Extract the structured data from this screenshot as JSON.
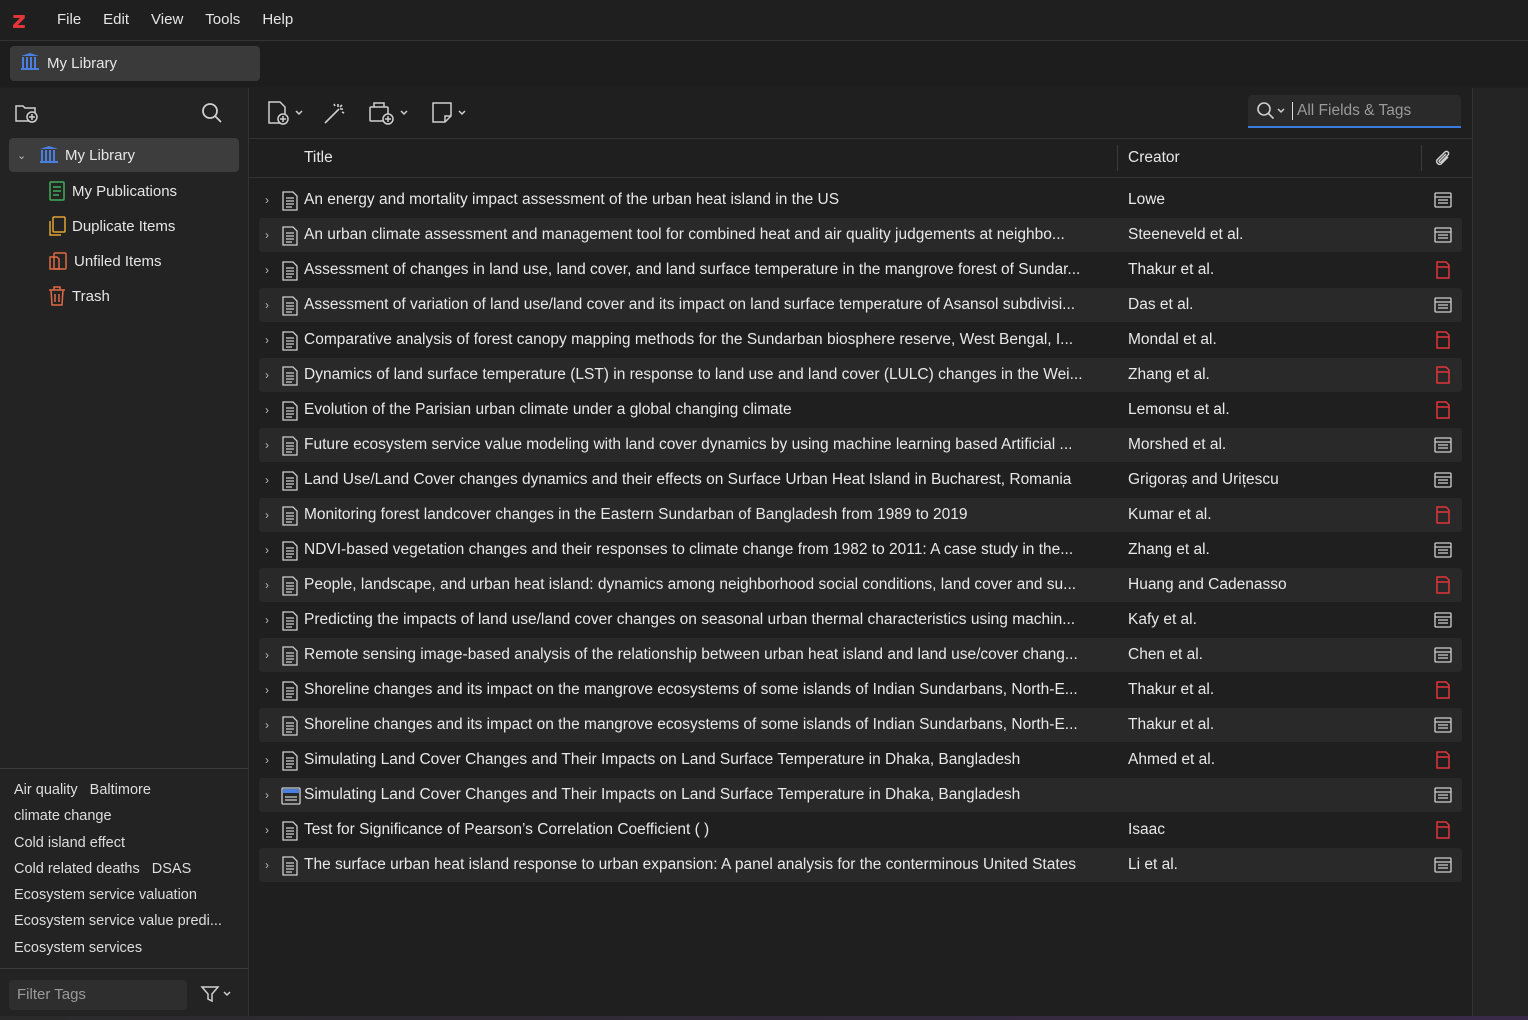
{
  "app": {
    "logo_letter": "z",
    "brand_color": "#e0353a"
  },
  "menu": [
    "File",
    "Edit",
    "View",
    "Tools",
    "Help"
  ],
  "tab": {
    "label": "My Library"
  },
  "sidebar": {
    "tree": [
      {
        "label": "My Library",
        "icon": "library-icon",
        "selected": true
      },
      {
        "label": "My Publications",
        "icon": "publications-icon"
      },
      {
        "label": "Duplicate Items",
        "icon": "duplicate-icon"
      },
      {
        "label": "Unfiled Items",
        "icon": "unfiled-icon"
      },
      {
        "label": "Trash",
        "icon": "trash-icon"
      }
    ],
    "tags": [
      [
        "Air quality",
        "Baltimore"
      ],
      [
        "climate change"
      ],
      [
        "Cold island effect"
      ],
      [
        "Cold related deaths",
        "DSAS"
      ],
      [
        "Ecosystem service valuation"
      ],
      [
        "Ecosystem service value predi..."
      ],
      [
        "Ecosystem services"
      ]
    ],
    "filter_placeholder": "Filter Tags"
  },
  "search": {
    "placeholder": "All Fields & Tags"
  },
  "columns": {
    "title": "Title",
    "creator": "Creator"
  },
  "items": [
    {
      "title": "An energy and mortality impact assessment of the urban heat island in the US",
      "creator": "Lowe",
      "att": "snapshot"
    },
    {
      "title": "An urban climate assessment and management tool for combined heat and air quality judgements at neighbo...",
      "creator": "Steeneveld et al.",
      "att": "snapshot"
    },
    {
      "title": "Assessment of changes in land use, land cover, and land surface temperature in the mangrove forest of Sundar...",
      "creator": "Thakur et al.",
      "att": "pdf"
    },
    {
      "title": "Assessment of variation of land use/land cover and its impact on land surface temperature of Asansol subdivisi...",
      "creator": "Das et al.",
      "att": "snapshot"
    },
    {
      "title": "Comparative analysis of forest canopy mapping methods for the Sundarban biosphere reserve, West Bengal, I...",
      "creator": "Mondal et al.",
      "att": "pdf"
    },
    {
      "title": "Dynamics of land surface temperature (LST) in response to land use and land cover (LULC) changes in the Wei...",
      "creator": "Zhang et al.",
      "att": "pdf"
    },
    {
      "title": "Evolution of the Parisian urban climate under a global changing climate",
      "creator": "Lemonsu et al.",
      "att": "pdf"
    },
    {
      "title": "Future ecosystem service value modeling with land cover dynamics by using machine learning based Artificial ...",
      "creator": "Morshed et al.",
      "att": "snapshot"
    },
    {
      "title": "Land Use/Land Cover changes dynamics and their effects on Surface Urban Heat Island in Bucharest, Romania",
      "creator": "Grigoraș and Urițescu",
      "att": "snapshot"
    },
    {
      "title": "Monitoring forest landcover changes in the Eastern Sundarban of Bangladesh from 1989 to 2019",
      "creator": "Kumar et al.",
      "att": "pdf"
    },
    {
      "title": "NDVI-based vegetation changes and their responses to climate change from 1982 to 2011: A case study in the...",
      "creator": "Zhang et al.",
      "att": "snapshot"
    },
    {
      "title": "People, landscape, and urban heat island: dynamics among neighborhood social conditions, land cover and su...",
      "creator": "Huang and Cadenasso",
      "att": "pdf"
    },
    {
      "title": "Predicting the impacts of land use/land cover changes on seasonal urban thermal characteristics using machin...",
      "creator": "Kafy et al.",
      "att": "snapshot"
    },
    {
      "title": "Remote sensing image-based analysis of the relationship between urban heat island and land use/cover chang...",
      "creator": "Chen et al.",
      "att": "snapshot"
    },
    {
      "title": "Shoreline changes and its impact on the mangrove ecosystems of some islands of Indian Sundarbans, North-E...",
      "creator": "Thakur et al.",
      "att": "pdf"
    },
    {
      "title": "Shoreline changes and its impact on the mangrove ecosystems of some islands of Indian Sundarbans, North-E...",
      "creator": "Thakur et al.",
      "att": "snapshot"
    },
    {
      "title": "Simulating Land Cover Changes and Their Impacts on Land Surface Temperature in Dhaka, Bangladesh",
      "creator": "Ahmed et al.",
      "att": "pdf"
    },
    {
      "title": "Simulating Land Cover Changes and Their Impacts on Land Surface Temperature in Dhaka, Bangladesh",
      "creator": "",
      "att": "snapshot",
      "type": "webpage"
    },
    {
      "title": "Test for Significance of Pearson’s Correlation Coefficient ( )",
      "creator": "Isaac",
      "att": "pdf"
    },
    {
      "title": "The surface urban heat island response to urban expansion: A panel analysis for the conterminous United States",
      "creator": "Li et al.",
      "att": "snapshot"
    }
  ]
}
